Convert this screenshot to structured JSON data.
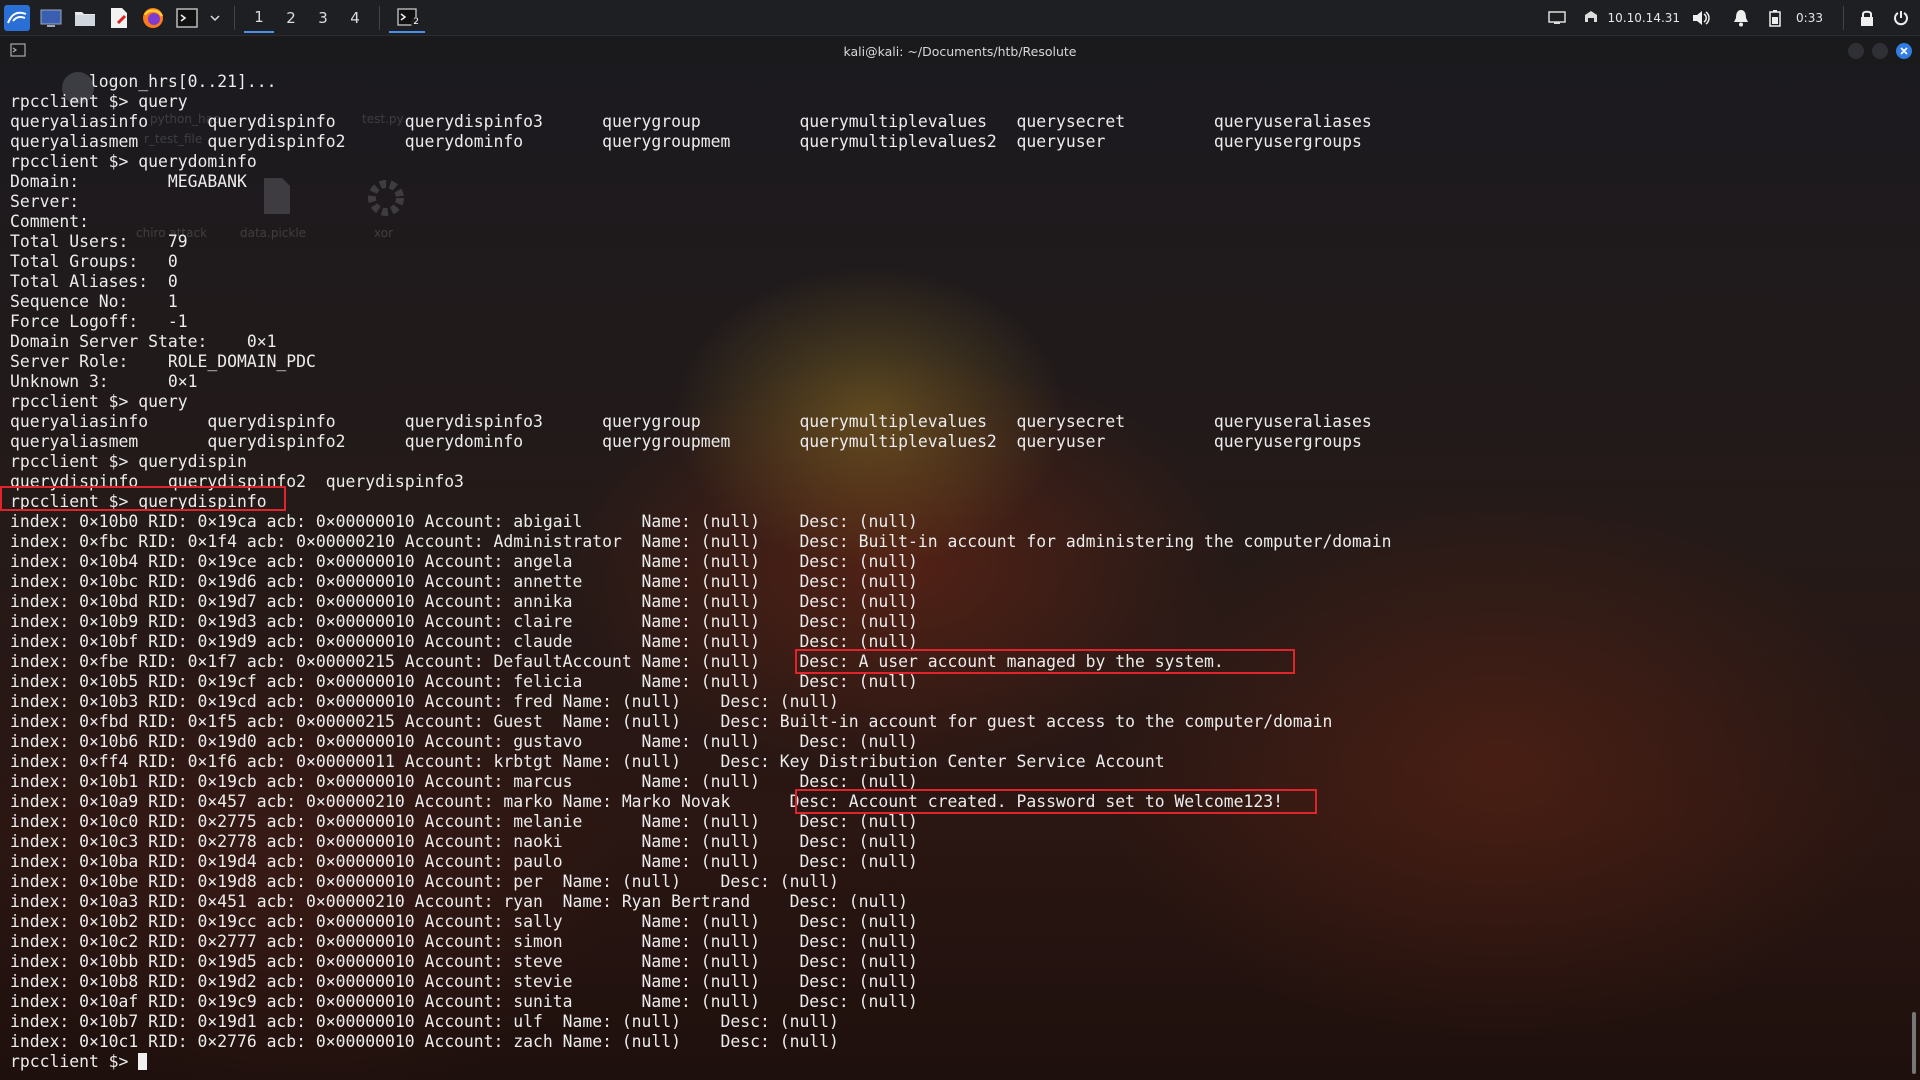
{
  "panel": {
    "workspaces": [
      "1",
      "2",
      "3",
      "4"
    ],
    "active_workspace": "1",
    "task_badge": "2",
    "ip_address": "10.10.14.31",
    "clock": "0:33"
  },
  "window": {
    "title": "kali@kali: ~/Documents/htb/Resolute"
  },
  "desktop_icons": {
    "labels": [
      "python_hac",
      "test.py",
      "r_test_file",
      "chiro attack",
      "data.pickle",
      "xor"
    ]
  },
  "terminal": {
    "lines": [
      "        logon_hrs[0..21]...",
      "rpcclient $> query",
      "queryaliasinfo      querydispinfo       querydispinfo3      querygroup          querymultiplevalues   querysecret         queryuseraliases",
      "queryaliasmem       querydispinfo2      querydominfo        querygroupmem       querymultiplevalues2  queryuser           queryusergroups",
      "rpcclient $> querydominfo",
      "Domain:         MEGABANK",
      "Server:",
      "Comment:",
      "Total Users:    79",
      "Total Groups:   0",
      "Total Aliases:  0",
      "Sequence No:    1",
      "Force Logoff:   -1",
      "Domain Server State:    0×1",
      "Server Role:    ROLE_DOMAIN_PDC",
      "Unknown 3:      0×1",
      "rpcclient $> query",
      "queryaliasinfo      querydispinfo       querydispinfo3      querygroup          querymultiplevalues   querysecret         queryuseraliases",
      "queryaliasmem       querydispinfo2      querydominfo        querygroupmem       querymultiplevalues2  queryuser           queryusergroups",
      "rpcclient $> querydispin",
      "querydispinfo   querydispinfo2  querydispinfo3",
      "rpcclient $> querydispinfo",
      "index: 0×10b0 RID: 0×19ca acb: 0×00000010 Account: abigail      Name: (null)    Desc: (null)",
      "index: 0×fbc RID: 0×1f4 acb: 0×00000210 Account: Administrator  Name: (null)    Desc: Built-in account for administering the computer/domain",
      "index: 0×10b4 RID: 0×19ce acb: 0×00000010 Account: angela       Name: (null)    Desc: (null)",
      "index: 0×10bc RID: 0×19d6 acb: 0×00000010 Account: annette      Name: (null)    Desc: (null)",
      "index: 0×10bd RID: 0×19d7 acb: 0×00000010 Account: annika       Name: (null)    Desc: (null)",
      "index: 0×10b9 RID: 0×19d3 acb: 0×00000010 Account: claire       Name: (null)    Desc: (null)",
      "index: 0×10bf RID: 0×19d9 acb: 0×00000010 Account: claude       Name: (null)    Desc: (null)",
      "index: 0×fbe RID: 0×1f7 acb: 0×00000215 Account: DefaultAccount Name: (null)    Desc: A user account managed by the system.",
      "index: 0×10b5 RID: 0×19cf acb: 0×00000010 Account: felicia      Name: (null)    Desc: (null)",
      "index: 0×10b3 RID: 0×19cd acb: 0×00000010 Account: fred Name: (null)    Desc: (null)",
      "index: 0×fbd RID: 0×1f5 acb: 0×00000215 Account: Guest  Name: (null)    Desc: Built-in account for guest access to the computer/domain",
      "index: 0×10b6 RID: 0×19d0 acb: 0×00000010 Account: gustavo      Name: (null)    Desc: (null)",
      "index: 0×ff4 RID: 0×1f6 acb: 0×00000011 Account: krbtgt Name: (null)    Desc: Key Distribution Center Service Account",
      "index: 0×10b1 RID: 0×19cb acb: 0×00000010 Account: marcus       Name: (null)    Desc: (null)",
      "index: 0×10a9 RID: 0×457 acb: 0×00000210 Account: marko Name: Marko Novak      Desc: Account created. Password set to Welcome123!",
      "index: 0×10c0 RID: 0×2775 acb: 0×00000010 Account: melanie      Name: (null)    Desc: (null)",
      "index: 0×10c3 RID: 0×2778 acb: 0×00000010 Account: naoki        Name: (null)    Desc: (null)",
      "index: 0×10ba RID: 0×19d4 acb: 0×00000010 Account: paulo        Name: (null)    Desc: (null)",
      "index: 0×10be RID: 0×19d8 acb: 0×00000010 Account: per  Name: (null)    Desc: (null)",
      "index: 0×10a3 RID: 0×451 acb: 0×00000210 Account: ryan  Name: Ryan Bertrand    Desc: (null)",
      "index: 0×10b2 RID: 0×19cc acb: 0×00000010 Account: sally        Name: (null)    Desc: (null)",
      "index: 0×10c2 RID: 0×2777 acb: 0×00000010 Account: simon        Name: (null)    Desc: (null)",
      "index: 0×10bb RID: 0×19d5 acb: 0×00000010 Account: steve        Name: (null)    Desc: (null)",
      "index: 0×10b8 RID: 0×19d2 acb: 0×00000010 Account: stevie       Name: (null)    Desc: (null)",
      "index: 0×10af RID: 0×19c9 acb: 0×00000010 Account: sunita       Name: (null)    Desc: (null)",
      "index: 0×10b7 RID: 0×19d1 acb: 0×00000010 Account: ulf  Name: (null)    Desc: (null)",
      "index: 0×10c1 RID: 0×2776 acb: 0×00000010 Account: zach Name: (null)    Desc: (null)"
    ],
    "prompt": "rpcclient $> "
  },
  "colors": {
    "highlight": "#e0242b",
    "accent": "#4b8fe8",
    "text": "#ececec"
  },
  "icons": [
    "kali-menu-icon",
    "desktop-icon",
    "file-manager-icon",
    "text-editor-icon",
    "firefox-icon",
    "terminal-icon",
    "dropdown-chevron-icon",
    "network-icon",
    "lock-network-icon",
    "volume-icon",
    "notification-bell-icon",
    "battery-icon",
    "lock-screen-icon",
    "power-icon"
  ]
}
